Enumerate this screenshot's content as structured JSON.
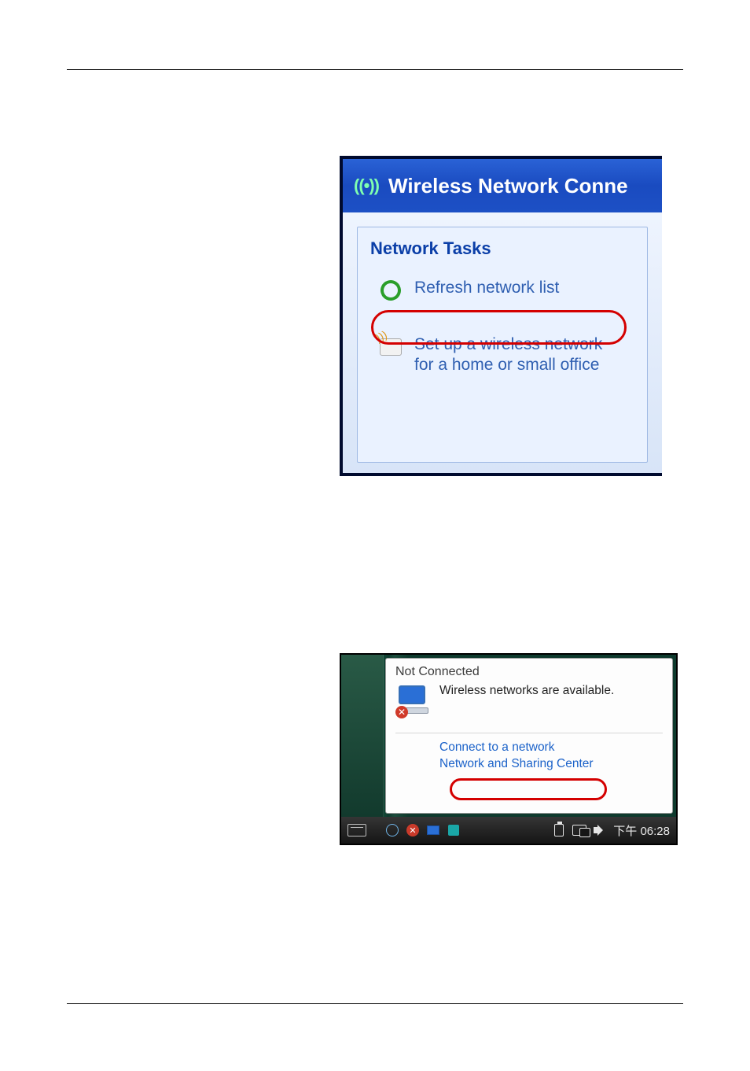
{
  "xp": {
    "window_title": "Wireless Network Conne",
    "panel_title": "Network Tasks",
    "refresh_label": "Refresh network list",
    "setup_label_line1": "Set up a wireless network",
    "setup_label_line2": "for a home or small office"
  },
  "vista": {
    "not_connected": "Not Connected",
    "available": "Wireless networks are available.",
    "connect_link": "Connect to a network",
    "sharing_link": "Network and Sharing Center",
    "clock": "下午 06:28"
  }
}
